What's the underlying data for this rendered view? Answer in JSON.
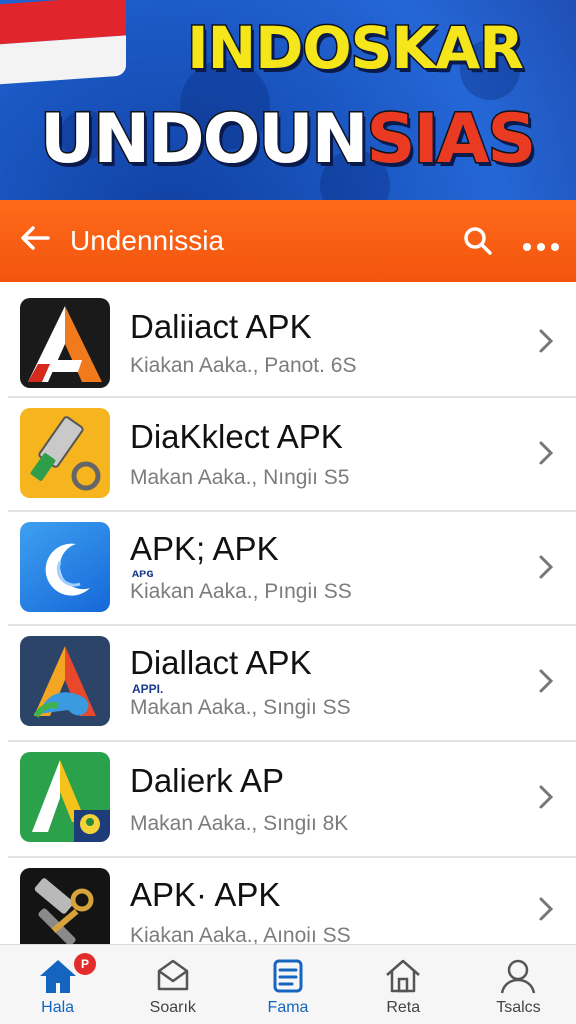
{
  "banner": {
    "line1": "INDOSKAR",
    "line2_white": "UNDOUN",
    "line2_red": "SIAS"
  },
  "appbar": {
    "title": "Undennissia",
    "back_icon": "arrow-left-icon",
    "search_icon": "search-icon",
    "more_icon": "more-horizontal-icon"
  },
  "apps": [
    {
      "title": "Daliiact APK",
      "tag": "",
      "subtitle": "Kiakan Aaka., Panot. 6S",
      "icon": "triangle-a-icon"
    },
    {
      "title": "DiaKklect APK",
      "tag": "",
      "subtitle": "Makan Aaka., Nıngiı S5",
      "icon": "tool-key-icon"
    },
    {
      "title": "APK; APK",
      "tag": "ᴀᴘɢ",
      "subtitle": "Kiakan Aaka., Pıngiı SS",
      "icon": "moon-icon"
    },
    {
      "title": "Diallact APK",
      "tag": "APPI.",
      "subtitle": "Makan Aaka., Sıngiı SS",
      "icon": "colorful-a-icon"
    },
    {
      "title": "Dalierk AP",
      "tag": "",
      "subtitle": "Makan Aaka., Sıngiı 8K",
      "icon": "green-a-icon"
    },
    {
      "title": "APK· APK",
      "tag": "",
      "subtitle": "Kiakan Aaka., Aınoiı SS",
      "icon": "hammer-key-icon"
    }
  ],
  "bottom_nav": [
    {
      "label": "Hala",
      "icon": "home-icon",
      "badge": "P",
      "active": true
    },
    {
      "label": "Soarık",
      "icon": "inbox-icon",
      "active": false
    },
    {
      "label": "Fama",
      "icon": "document-icon",
      "active": false
    },
    {
      "label": "Reta",
      "icon": "house-outline-icon",
      "active": false
    },
    {
      "label": "Tsalcs",
      "icon": "user-icon",
      "active": false
    }
  ],
  "colors": {
    "accent": "#f2540e",
    "banner_blue": "#1f5ec8",
    "active_nav": "#1565c0"
  }
}
